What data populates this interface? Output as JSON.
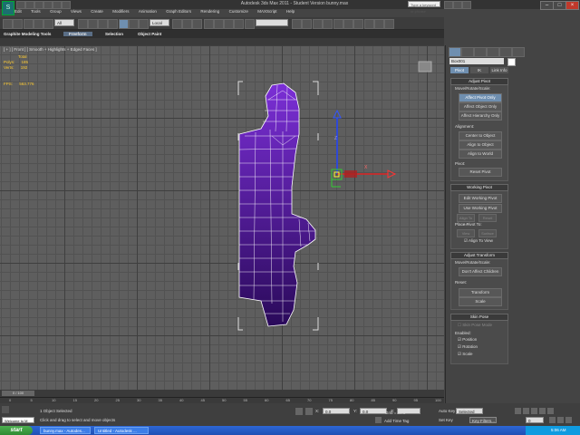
{
  "window": {
    "title": "Autodesk 3ds Max  2011  -  Student Version    bunny.max",
    "logo": "S",
    "search_placeholder": "Type a keyword or phrase",
    "minimize": "–",
    "maximize": "□",
    "close": "×"
  },
  "menu": [
    "Edit",
    "Tools",
    "Group",
    "Views",
    "Create",
    "Modifiers",
    "Animation",
    "Graph Editors",
    "Rendering",
    "Customize",
    "MAXScript",
    "Help"
  ],
  "toolbar": {
    "selection_filter": "All",
    "ref_coord": "Local"
  },
  "ribbon": {
    "tabs": [
      "Graphite Modeling Tools",
      "Freeform",
      "Selection",
      "Object Paint"
    ],
    "selected_tab": "Freeform"
  },
  "viewport": {
    "label": "[ + ] [ Front ] [ Smooth + Highlights + Edged Faces ]",
    "stats": {
      "header": "Total",
      "polys_label": "Polys:",
      "polys": "185",
      "verts_label": "Verts:",
      "verts": "192",
      "fps_label": "FPS:",
      "fps": "563.776"
    },
    "axis_labels": {
      "z": "Z",
      "x": "X"
    }
  },
  "command_panel": {
    "object_name": "Box001",
    "subtabs": [
      "Pivot",
      "IK",
      "Link Info"
    ],
    "selected_subtab": "Pivot",
    "adjust_pivot": {
      "header": "Adjust Pivot",
      "move_label": "Move/Rotate/Scale:",
      "affect_pivot_only": "Affect Pivot Only",
      "affect_object_only": "Affect Object Only",
      "affect_hierarchy_only": "Affect Hierarchy Only",
      "alignment_label": "Alignment:",
      "center_to_object": "Center to Object",
      "align_to_object": "Align to Object",
      "align_to_world": "Align to World",
      "pivot_label": "Pivot:",
      "reset_pivot": "Reset Pivot"
    },
    "working_pivot": {
      "header": "Working Pivot",
      "edit_working_pivot": "Edit Working Pivot",
      "use_working_pivot": "Use Working Pivot",
      "align_to_view_btn": "Align To View",
      "reset_btn": "Reset",
      "place_pivot_label": "Place Pivot To:",
      "view_btn": "View",
      "surface_btn": "Surface",
      "align_to_view_check": "Align To View"
    },
    "adjust_transform": {
      "header": "Adjust Transform",
      "move_label": "Move/Rotate/Scale:",
      "dont_affect_children": "Don't Affect Children",
      "reset_label": "Reset:",
      "transform": "Transform",
      "scale": "Scale"
    },
    "skin_pose": {
      "header": "Skin Pose",
      "skin_pose_mode": "Skin Pose Mode",
      "enabled_label": "Enabled:",
      "position": "Position",
      "rotation": "Rotation",
      "scale": "Scale"
    }
  },
  "timeline": {
    "slider": "0 / 100",
    "ticks": [
      "0",
      "5",
      "10",
      "15",
      "20",
      "25",
      "30",
      "35",
      "40",
      "45",
      "50",
      "55",
      "60",
      "65",
      "70",
      "75",
      "80",
      "85",
      "90",
      "95",
      "100"
    ]
  },
  "status": {
    "listener": "Welcome to M",
    "selected_count": "1 Object Selected",
    "prompt": "Click and drag to select and move objects",
    "x_label": "X:",
    "x": "0.0",
    "y_label": "Y:",
    "y": "0.0",
    "z_label": "Z:",
    "z": "",
    "grid": "Grid = 10.0",
    "add_time_tag": "Add Time Tag",
    "auto_key": "Auto Key",
    "set_key": "Set Key",
    "key_mode": "Selected",
    "key_filters": "Key Filters...",
    "frame": "0"
  },
  "taskbar": {
    "start": "start",
    "tasks": [
      "bunny.max - Autodes...",
      "Untitled - Autodesk ..."
    ],
    "clock": "5:06 AM"
  }
}
